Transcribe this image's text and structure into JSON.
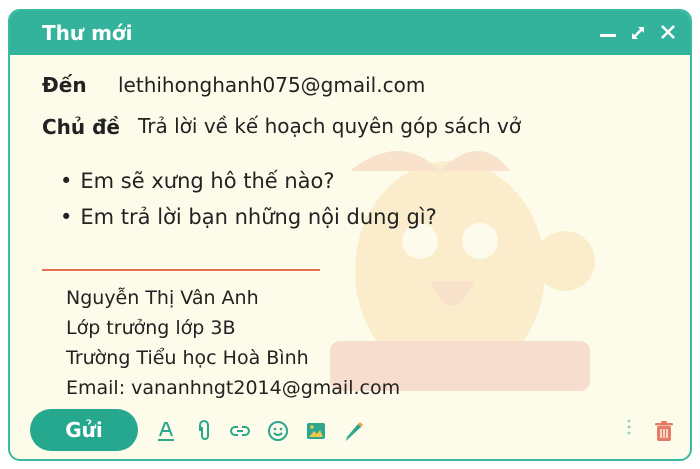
{
  "window": {
    "title": "Thư mới",
    "controls": [
      "minimize-icon",
      "expand-icon",
      "close-icon"
    ]
  },
  "to": {
    "label": "Đến",
    "value": "lethihonghanh075@gmail.com"
  },
  "subject": {
    "label": "Chủ đề",
    "value": "Trả lời về kế hoạch quyên góp sách vở"
  },
  "body": {
    "bullets": [
      "Em sẽ xưng hô thế nào?",
      "Em trả lời bạn những nội dung gì?"
    ]
  },
  "signature": {
    "name": "Nguyễn Thị Vân Anh",
    "role": "Lớp trưởng lớp 3B",
    "school": "Trường Tiểu học Hoà Bình",
    "email": "Email: vananhngt2014@gmail.com"
  },
  "toolbar": {
    "send_label": "Gửi",
    "icons": [
      "text-format-icon",
      "attachment-icon",
      "link-icon",
      "emoji-icon",
      "image-icon",
      "pen-icon",
      "more-icon",
      "trash-icon"
    ]
  },
  "colors": {
    "accent": "#33b39c",
    "send": "#26a88f",
    "divider": "#e1714f",
    "background": "#fdfbe9",
    "icon": "#2aa78d",
    "trash": "#e57b67"
  }
}
